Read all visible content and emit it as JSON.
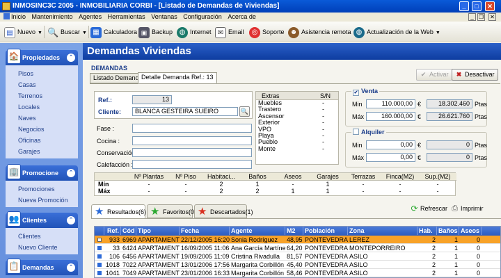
{
  "window": {
    "title": "INMOSINC3C 2005  -  INMOBILIARIA CORBI - [Listado de Demandas de Viviendas]"
  },
  "menu": [
    "Inicio",
    "Mantenimiento",
    "Agentes",
    "Herramientas",
    "Ventanas",
    "Configuración",
    "Acerca de"
  ],
  "toolbar": {
    "nuevo": "Nuevo",
    "buscar": "Buscar",
    "calculadora": "Calculadora",
    "backup": "Backup",
    "internet": "Internet",
    "email": "Email",
    "soporte": "Soporte",
    "asistencia": "Asistencia remota",
    "actualizacion": "Actualización de la Web"
  },
  "sidebar": {
    "propiedades": {
      "title": "Propiedades",
      "items": [
        "Pisos",
        "Casas",
        "Terrenos",
        "Locales",
        "Naves",
        "Negocios",
        "Oficinas",
        "Garajes"
      ]
    },
    "promocione": {
      "title": "Promocione",
      "items": [
        "Promociones",
        "Nueva Promoción"
      ]
    },
    "clientes": {
      "title": "Clientes",
      "items": [
        "Clientes",
        "Nuevo Cliente"
      ]
    },
    "demandas": {
      "title": "Demandas"
    }
  },
  "main": {
    "title": "Demandas Viviendas",
    "section": "DEMANDAS",
    "tabs": [
      "Listado Demandas",
      "Detalle Demanda Ref.: 13"
    ],
    "activar": "Activar",
    "desactivar": "Desactivar",
    "ref_label": "Ref.:",
    "ref_value": "13",
    "cliente_label": "Cliente:",
    "cliente_value": "BLANCA GESTEIRA SUEIRO",
    "fase_label": "Fase :",
    "cocina_label": "Cocina :",
    "conservacion_label": "Conservación :",
    "calefaccion_label": "Calefacción :"
  },
  "extras": {
    "header": "Extras",
    "sn": "S/N",
    "rows": [
      [
        "Muebles",
        "-"
      ],
      [
        "Trastero",
        "-"
      ],
      [
        "Ascensor",
        "-"
      ],
      [
        "Exterior",
        "-"
      ],
      [
        "VPO",
        "-"
      ],
      [
        "Playa",
        "-"
      ],
      [
        "Pueblo",
        "-"
      ],
      [
        "Monte",
        "-"
      ]
    ]
  },
  "venta": {
    "title": "Venta",
    "min_label": "Min",
    "max_label": "Máx",
    "min": "110.000,00",
    "max": "160.000,00",
    "min_ptas": "18.302.460",
    "max_ptas": "26.621.760",
    "euro": "€",
    "ptas": "Ptas"
  },
  "alquiler": {
    "title": "Alquiler",
    "min_label": "Min",
    "max_label": "Máx",
    "min": "0,00",
    "max": "0,00",
    "min_ptas": "0",
    "max_ptas": "0",
    "euro": "€",
    "ptas": "Ptas"
  },
  "minmax": {
    "headers": [
      "",
      "Nº Plantas",
      "Nº Piso",
      "Habitaci...",
      "Baños",
      "Aseos",
      "Garajes",
      "Terrazas",
      "Finca(M2)",
      "Sup.(M2)"
    ],
    "rows": [
      [
        "Mín",
        "-",
        "-",
        "2",
        "1",
        "-",
        "1",
        "-",
        "-",
        "-"
      ],
      [
        "Máx",
        "-",
        "-",
        "2",
        "2",
        "1",
        "1",
        "-",
        "-",
        "-"
      ]
    ]
  },
  "results": {
    "tabs": [
      "Resultados(6)",
      "Favoritos(0)",
      "Descartados(1)"
    ],
    "refrescar": "Refrescar",
    "imprimir": "Imprimir"
  },
  "grid": {
    "headers": [
      "Ref.",
      "Cód",
      "Tipo",
      "Fecha",
      "Agente",
      "M2",
      "Población",
      "Zona",
      "Hab.",
      "Baños",
      "Aseos",
      ""
    ],
    "rows": [
      [
        "933",
        "6969",
        "APARTAMENTO",
        "22/12/2005 16:20",
        "Sonia Rodríguez",
        "48,95",
        "PONTEVEDRA",
        "LEREZ",
        "2",
        "1",
        "0"
      ],
      [
        "33",
        "6424",
        "APARTAMENTO",
        "16/09/2005 11:06",
        "Ana García Martínez",
        "64,20",
        "PONTEVEDRA",
        "MONTEPORREIRO",
        "2",
        "1",
        "0"
      ],
      [
        "106",
        "6456",
        "APARTAMENTO",
        "19/09/2005 11:09",
        "Cristina Rivadulla",
        "81,57",
        "PONTEVEDRA",
        "ASILO",
        "2",
        "1",
        "0"
      ],
      [
        "1018",
        "7022",
        "APARTAMENTO",
        "13/01/2006 17:56",
        "Margarita Corbillón",
        "45,40",
        "PONTEVEDRA",
        "ASILO",
        "2",
        "1",
        "0"
      ],
      [
        "1041",
        "7049",
        "APARTAMENTO",
        "23/01/2006 16:33",
        "Margarita Corbillón",
        "58,46",
        "PONTEVEDRA",
        "ASILO",
        "2",
        "1",
        "0"
      ]
    ]
  }
}
